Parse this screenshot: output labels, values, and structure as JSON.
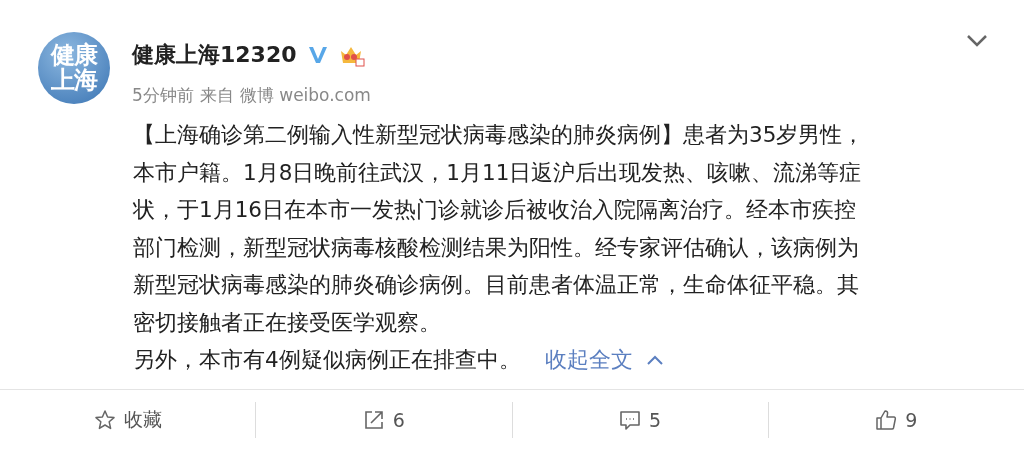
{
  "post": {
    "avatar": {
      "lines": [
        "健康",
        "上海"
      ]
    },
    "author": "健康上海12320",
    "verified": true,
    "member_badge": true,
    "time": "5分钟前",
    "source_prefix": "来自",
    "source": "微博 weibo.com",
    "paragraphs": [
      "【上海确诊第二例输入性新型冠状病毒感染的肺炎病例】患者为35岁男性，本市户籍。1月8日晚前往武汉，1月11日返沪后出现发热、咳嗽、流涕等症状，于1月16日在本市一发热门诊就诊后被收治入院隔离治疗。经本市疾控部门检测，新型冠状病毒核酸检测结果为阳性。经专家评估确认，该病例为新型冠状病毒感染的肺炎确诊病例。目前患者体温正常，生命体征平稳。其密切接触者正在接受医学观察。",
      "另外，本市有4例疑似病例正在排查中。"
    ],
    "collapse_link": "收起全文"
  },
  "actions": [
    {
      "kind": "favorite",
      "label": "收藏"
    },
    {
      "kind": "repost",
      "label": "6"
    },
    {
      "kind": "comment",
      "label": "5"
    },
    {
      "kind": "like",
      "label": "9"
    }
  ]
}
